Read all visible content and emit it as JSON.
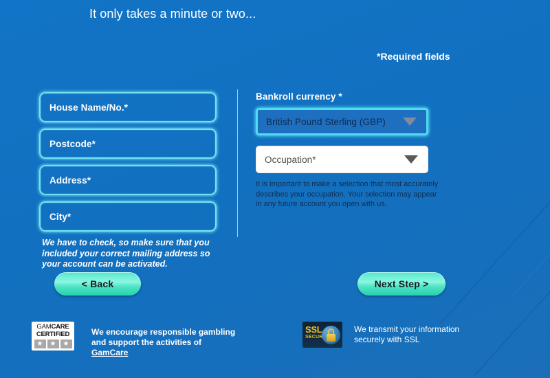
{
  "page": {
    "headline": "It only takes a minute or two...",
    "required_note": "*Required fields",
    "background_color": "#1272c4",
    "accent_color": "#72e4f0",
    "button_color": "#6ef0d8"
  },
  "left_column": {
    "fields": [
      {
        "name": "house-name",
        "placeholder": "House Name/No.*"
      },
      {
        "name": "postcode",
        "placeholder": "Postcode*"
      },
      {
        "name": "address",
        "placeholder": "Address*"
      },
      {
        "name": "city",
        "placeholder": "City*"
      }
    ],
    "hint": "We have to check, so make sure that you included your correct mailing address so your account can be activated."
  },
  "right_column": {
    "currency_label": "Bankroll currency *",
    "currency_value": "British Pound Sterling (GBP)",
    "occupation_value": "Occupation*",
    "occupation_hint": "It is important to make a selection that most accurately describes your occupation. Your selection may appear in any future account you open with us.",
    "dropdown_icon": "chevron-down-icon"
  },
  "buttons": {
    "back": "< Back",
    "next": "Next Step >"
  },
  "footer": {
    "gamcare": {
      "logo_gam": "GAM",
      "logo_care": "CARE",
      "logo_certified": "CERTIFIED",
      "star_glyph": "★",
      "text_before": "We encourage responsible gambling and support the activities of ",
      "link_text": "GamCare"
    },
    "ssl": {
      "badge_title": "SSL",
      "badge_sub": "SECURE",
      "text": "We transmit your information securely with SSL"
    }
  }
}
